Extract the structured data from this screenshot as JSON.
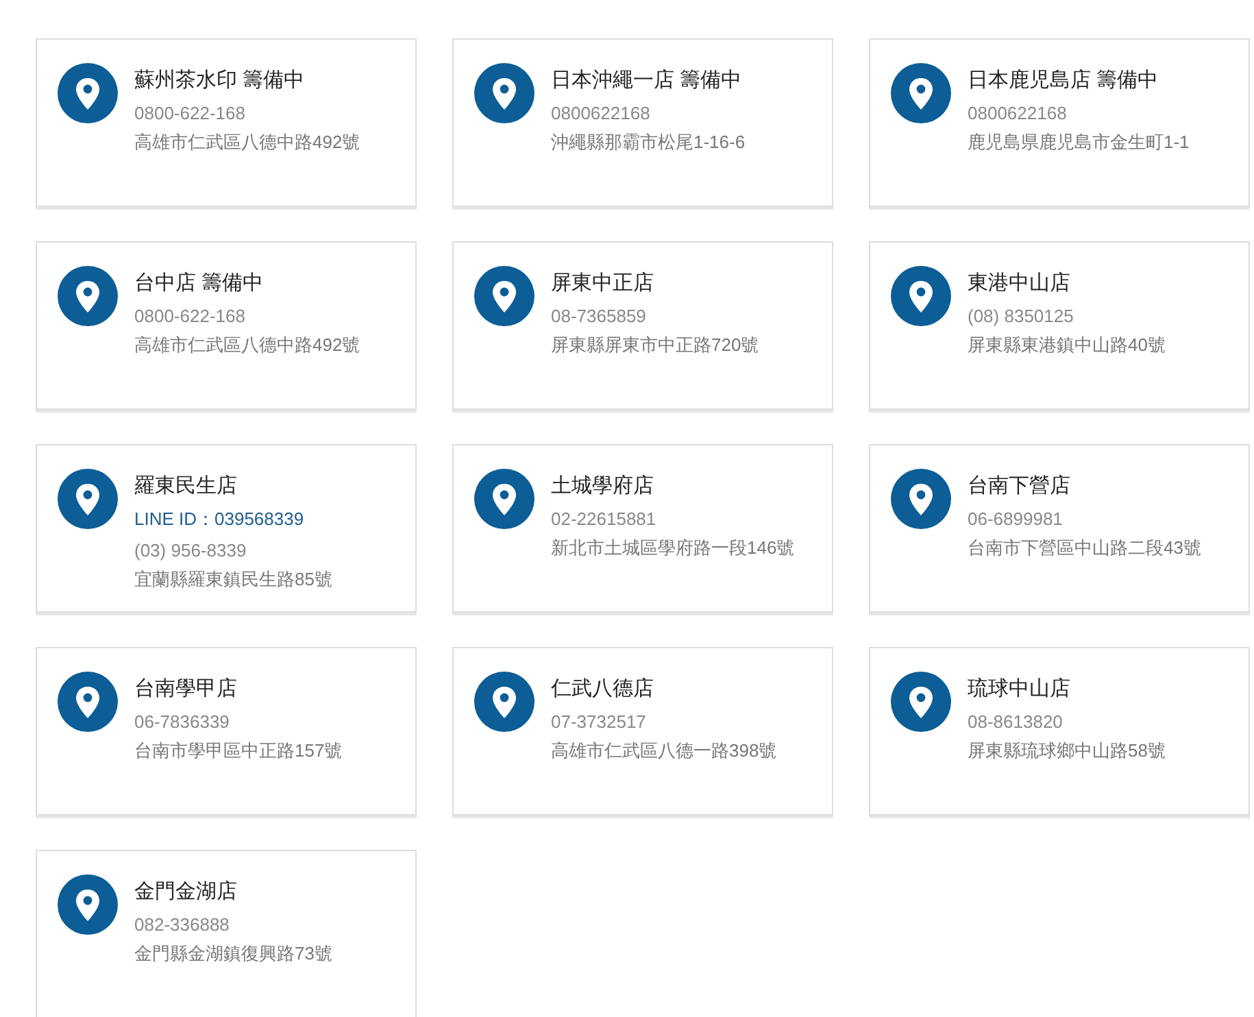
{
  "stores": [
    {
      "name": "蘇州茶水印 籌備中",
      "lines": [
        {
          "kind": "phone",
          "text": "0800-622-168"
        },
        {
          "kind": "address",
          "text": "高雄市仁武區八德中路492號"
        }
      ]
    },
    {
      "name": "日本沖繩一店 籌備中",
      "lines": [
        {
          "kind": "phone",
          "text": "0800622168"
        },
        {
          "kind": "address",
          "text": "沖繩縣那霸市松尾1-16-6"
        }
      ]
    },
    {
      "name": "日本鹿児島店 籌備中",
      "lines": [
        {
          "kind": "phone",
          "text": "0800622168"
        },
        {
          "kind": "address",
          "text": "鹿児島県鹿児島市金生町1-1"
        }
      ]
    },
    {
      "name": "台中店 籌備中",
      "lines": [
        {
          "kind": "phone",
          "text": "0800-622-168"
        },
        {
          "kind": "address",
          "text": "高雄市仁武區八德中路492號"
        }
      ]
    },
    {
      "name": "屏東中正店",
      "lines": [
        {
          "kind": "phone",
          "text": "08-7365859"
        },
        {
          "kind": "address",
          "text": "屏東縣屏東市中正路720號"
        }
      ]
    },
    {
      "name": "東港中山店",
      "lines": [
        {
          "kind": "phone",
          "text": "(08) 8350125"
        },
        {
          "kind": "address",
          "text": "屏東縣東港鎮中山路40號"
        }
      ]
    },
    {
      "name": "羅東民生店",
      "lines": [
        {
          "kind": "line_id",
          "text": "LINE ID：039568339"
        },
        {
          "kind": "phone",
          "text": "(03) 956-8339"
        },
        {
          "kind": "address",
          "text": "宜蘭縣羅東鎮民生路85號"
        }
      ]
    },
    {
      "name": "土城學府店",
      "lines": [
        {
          "kind": "phone",
          "text": "02-22615881"
        },
        {
          "kind": "address",
          "text": "新北市土城區學府路一段146號"
        }
      ]
    },
    {
      "name": "台南下營店",
      "lines": [
        {
          "kind": "phone",
          "text": "06-6899981"
        },
        {
          "kind": "address",
          "text": "台南市下營區中山路二段43號"
        }
      ]
    },
    {
      "name": "台南學甲店",
      "lines": [
        {
          "kind": "phone",
          "text": "06-7836339"
        },
        {
          "kind": "address",
          "text": "台南市學甲區中正路157號"
        }
      ]
    },
    {
      "name": "仁武八德店",
      "lines": [
        {
          "kind": "phone",
          "text": "07-3732517"
        },
        {
          "kind": "address",
          "text": "高雄市仁武區八德一路398號"
        }
      ]
    },
    {
      "name": "琉球中山店",
      "lines": [
        {
          "kind": "phone",
          "text": "08-8613820"
        },
        {
          "kind": "address",
          "text": "屏東縣琉球鄉中山路58號"
        }
      ]
    },
    {
      "name": "金門金湖店",
      "lines": [
        {
          "kind": "phone",
          "text": "082-336888"
        },
        {
          "kind": "address",
          "text": "金門縣金湖鎮復興路73號"
        }
      ]
    }
  ]
}
